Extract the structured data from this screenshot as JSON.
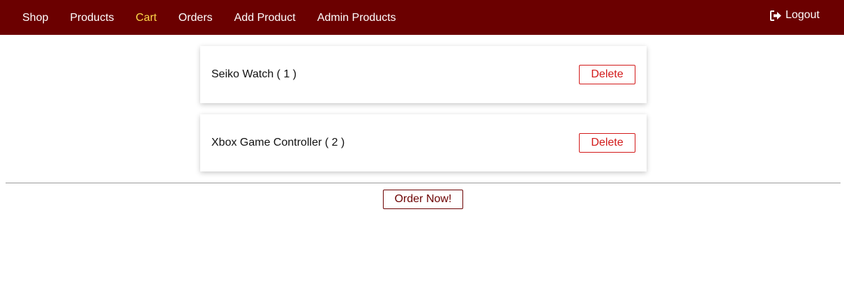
{
  "nav": {
    "items": [
      {
        "label": "Shop",
        "active": false
      },
      {
        "label": "Products",
        "active": false
      },
      {
        "label": "Cart",
        "active": true
      },
      {
        "label": "Orders",
        "active": false
      },
      {
        "label": "Add Product",
        "active": false
      },
      {
        "label": "Admin Products",
        "active": false
      }
    ],
    "logout": {
      "label": "Logout",
      "icon": "sign-out-icon"
    }
  },
  "cart": {
    "items": [
      {
        "text": "Seiko Watch ( 1 )",
        "delete_label": "Delete"
      },
      {
        "text": "Xbox Game Controller ( 2 )",
        "delete_label": "Delete"
      }
    ],
    "order_button_label": "Order Now!"
  },
  "colors": {
    "navbar_bg": "#6b0000",
    "active_link": "#ffd84a",
    "delete_red": "#d21919"
  }
}
